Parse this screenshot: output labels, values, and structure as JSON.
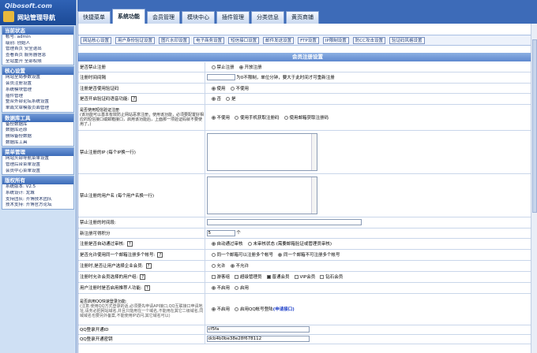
{
  "logo": {
    "line1": "Qibosoft.com",
    "line2": "网站管理导航"
  },
  "sidebar": {
    "sections": [
      {
        "title": "当前状态",
        "rows": [
          "帐号: admin",
          "级别: 创始人",
          "管理首页 安全退出",
          "查看首页 服务器信息",
          "全站重开 全部权限"
        ]
      },
      {
        "title": "核心设置",
        "rows": [
          "网站全局参数设置",
          "会员注册设置",
          "系统模块管理",
          "插件管理",
          "整合外部论坛系统设置",
          "单篇文章模版页面管理"
        ]
      },
      {
        "title": "数据库工具",
        "rows": [
          "备份数据库",
          "数据库还原",
          "删除备份数据",
          "数据库工具"
        ]
      },
      {
        "title": "菜单管理",
        "rows": [
          "网站头部导航菜单设置",
          "管理后台菜单设置",
          "会员中心菜单设置"
        ]
      },
      {
        "title": "版权所有",
        "rows": [
          "系统版本: V2.5",
          "系统设计: 龙城",
          "支持团队: 齐博技术团队",
          "技术支持: 齐博官方论坛"
        ]
      }
    ]
  },
  "tabs": [
    "快捷菜单",
    "系统功能",
    "会员管理",
    "模块中心",
    "插件管理",
    "分类信息",
    "黄页商铺"
  ],
  "active_tab": "系统功能",
  "subtabs": [
    "网站核心设置",
    "用户身份验证设置",
    "图片水印设置",
    "电子商务设置",
    "短信接口设置",
    "邮件发送设置",
    "FTP设置",
    "IP限制设置",
    "防CC攻击设置",
    "验证码风格设置"
  ],
  "form_title": "会员注册设置",
  "rows": {
    "r1": {
      "label": "是否禁止注册",
      "opt1": "禁止注册",
      "opt2": "开放注册"
    },
    "r2": {
      "label": "注册时间间隔",
      "hint": "为0不限制，单位分钟，要大于此时间才可重新注册"
    },
    "r3": {
      "label": "注册是否使用验证码",
      "opt1": "使用",
      "opt2": "不使用"
    },
    "r4": {
      "label": "是否开启验证码语音功能:",
      "opt1": "否",
      "opt2": "是"
    },
    "r5": {
      "label": "是否使用短信验证注册",
      "desc": "(该功能可以基本有效防止网站恶意注册，使用该功能，必须要配置好相应的短信接口或邮箱接口，启用该功能后，上面那一项验证码就不要使用了。)",
      "opt1": "不使用",
      "opt2": "使用手机获取注册码",
      "opt3": "使用邮箱获取注册码"
    },
    "r6": {
      "label": "禁止注册的IP (每个IP换一行)"
    },
    "r7": {
      "label": "禁止注册的用户名 (每个用户名换一行)"
    },
    "r8": {
      "label": "禁止注册的时间段:"
    },
    "r9": {
      "label": "新注册可得积分",
      "value": "5",
      "unit": "个"
    },
    "r10": {
      "label": "注册是否自动通过审核:",
      "opt1": "自动通过审核",
      "opt2": "未审核状态 (需要邮箱验证或管理员审核)"
    },
    "r11": {
      "label": "是否允许使用同一个邮箱注册多个帐号:",
      "opt1": "同一个邮箱可以注册多个帐号",
      "opt2": "同一个邮箱不可注册多个帐号"
    },
    "r12": {
      "label": "注册时,是否让用户选择企业会员:",
      "opt1": "允许",
      "opt2": "不允许"
    },
    "r13": {
      "label": "注册时允许会员选择的用户组:",
      "opt1": "游客组",
      "opt2": "超级管理员",
      "opt3": "普通会员",
      "opt4": "VIP会员",
      "opt5": "钻石会员"
    },
    "r14": {
      "label": "用户注册时是否启用推荐人功能:",
      "opt1": "不启用",
      "opt2": "启用"
    },
    "r15": {
      "label": "是否启用QQ快速登录功能:",
      "desc": "(注意:使用QQ方式登录的话,必须要先申请API接口,QQ互联接口申请地址,请务必把网站域名,并且只能用在一个域名,不能用在其它二级域名,同域域名也要另外备案,不能使用IP访问,其它域名可以)",
      "opt1": "不启用",
      "opt2": "启用QQ帐号登陆",
      "link": "申请接口"
    },
    "r16": {
      "label": "QQ登录开通ID",
      "value": "cf5fa"
    },
    "r17": {
      "label": "QQ登录开通密钥",
      "value": "dcb4b0be38e28f678112"
    }
  }
}
